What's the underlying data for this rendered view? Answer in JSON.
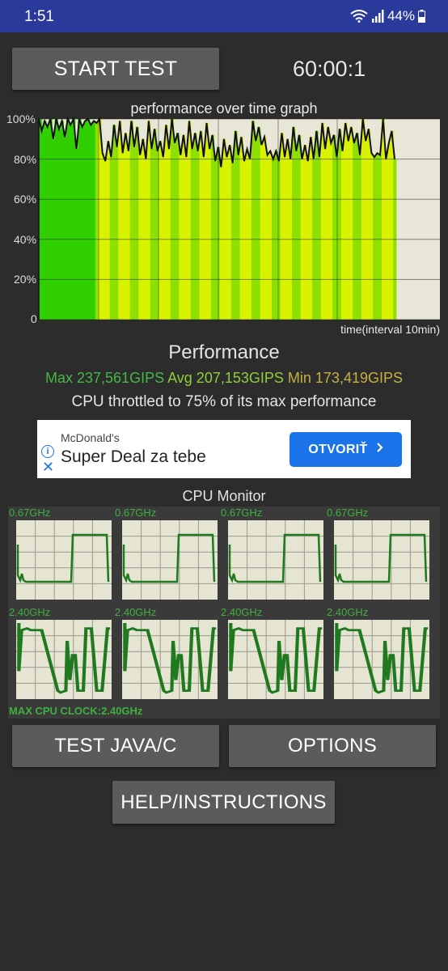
{
  "status_bar": {
    "time": "1:51",
    "battery_percent": "44%",
    "icons": [
      "wifi-icon",
      "signal-icon",
      "battery-icon"
    ]
  },
  "controls": {
    "start_test_label": "START TEST",
    "timer": "60:00:1"
  },
  "perf_graph": {
    "title": "performance over time graph",
    "y_ticks": [
      "100%",
      "80%",
      "60%",
      "40%",
      "20%",
      "0"
    ],
    "x_label": "time(interval 10min)",
    "colors": {
      "high": "#30d000",
      "mid": "#d8f200",
      "background": "#e8e6d6"
    }
  },
  "chart_data": {
    "type": "area",
    "title": "performance over time graph",
    "xlabel": "time(interval 10min)",
    "ylabel": "",
    "ylim": [
      0,
      100
    ],
    "values": [
      100,
      94,
      99,
      96,
      100,
      90,
      100,
      95,
      99,
      91,
      100,
      97,
      100,
      85,
      100,
      96,
      99,
      100,
      97,
      99,
      98,
      100,
      83,
      79,
      89,
      81,
      97,
      86,
      99,
      83,
      93,
      84,
      99,
      86,
      96,
      82,
      90,
      80,
      99,
      85,
      95,
      84,
      89,
      81,
      97,
      85,
      100,
      88,
      93,
      82,
      92,
      81,
      99,
      85,
      93,
      84,
      94,
      81,
      98,
      85,
      92,
      79,
      86,
      76,
      90,
      81,
      87,
      78,
      94,
      82,
      91,
      79,
      85,
      80,
      99,
      89,
      96,
      87,
      91,
      82,
      84,
      80,
      84,
      79,
      93,
      81,
      90,
      80,
      96,
      84,
      92,
      80,
      87,
      79,
      91,
      80,
      94,
      81,
      98,
      85,
      96,
      88,
      92,
      81,
      95,
      84,
      98,
      89,
      96,
      88,
      93,
      82,
      100,
      89,
      95,
      83,
      81,
      83,
      82,
      100,
      80,
      88,
      94,
      80
    ]
  },
  "performance": {
    "title": "Performance",
    "max": "Max 237,561GIPS",
    "avg": "Avg 207,153GIPS",
    "min": "Min 173,419GIPS",
    "throttle_text": "CPU throttled to 75% of its max performance"
  },
  "ad": {
    "brand": "McDonald's",
    "headline": "Super Deal za tebe",
    "cta_label": "OTVORIŤ",
    "cta_color": "#1a73e8"
  },
  "cpu_monitor": {
    "title": "CPU Monitor",
    "cores": [
      {
        "freq": "0.67GHz"
      },
      {
        "freq": "0.67GHz"
      },
      {
        "freq": "0.67GHz"
      },
      {
        "freq": "0.67GHz"
      },
      {
        "freq": "2.40GHz"
      },
      {
        "freq": "2.40GHz"
      },
      {
        "freq": "2.40GHz"
      },
      {
        "freq": "2.40GHz"
      }
    ],
    "max_clock": "MAX CPU CLOCK:2.40GHz",
    "line_color": "#1f7a1f"
  },
  "buttons": {
    "test_java_c": "TEST JAVA/C",
    "options": "OPTIONS",
    "help": "HELP/INSTRUCTIONS"
  }
}
